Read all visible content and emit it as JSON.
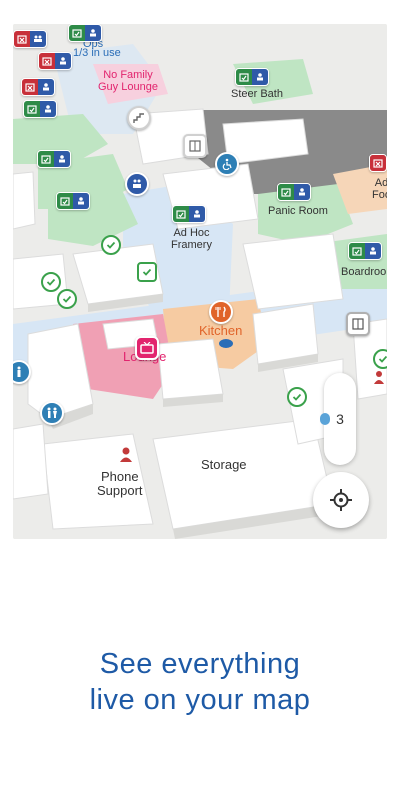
{
  "map": {
    "rooms": {
      "ops": "Ops",
      "ops_usage": "1/3 in use",
      "no_family_guy": "No Family\nGuy Lounge",
      "steer_bath": "Steer Bath",
      "panic_room": "Panic Room",
      "ad_hoc": "Ad Hoc\nFramery",
      "ad_foo": "Ad\nFoo",
      "boardroom": "Boardroo",
      "kitchen": "Kitchen",
      "lounge": "Lounge",
      "phone_support": "Phone\nSupport",
      "storage": "Storage"
    },
    "colors": {
      "lounge": "#f0a0b4",
      "kitchen": "#f6cba2",
      "corridor": "#d7e6f5",
      "green_room": "#bfe5c3",
      "available": "#3aa14b",
      "occupied": "#c8303a",
      "info": "#2f5aa8"
    },
    "icons": [
      "tv-icon",
      "fork-knife-icon",
      "wheelchair-icon",
      "restroom-icon",
      "stairs-icon",
      "elevator-icon",
      "person-icon",
      "checkmark-icon",
      "calendar-icon",
      "people-icon"
    ]
  },
  "controls": {
    "floor": "3",
    "locate_icon": "crosshair-icon"
  },
  "tagline": {
    "line1": "See everything",
    "line2": "live on your map"
  }
}
